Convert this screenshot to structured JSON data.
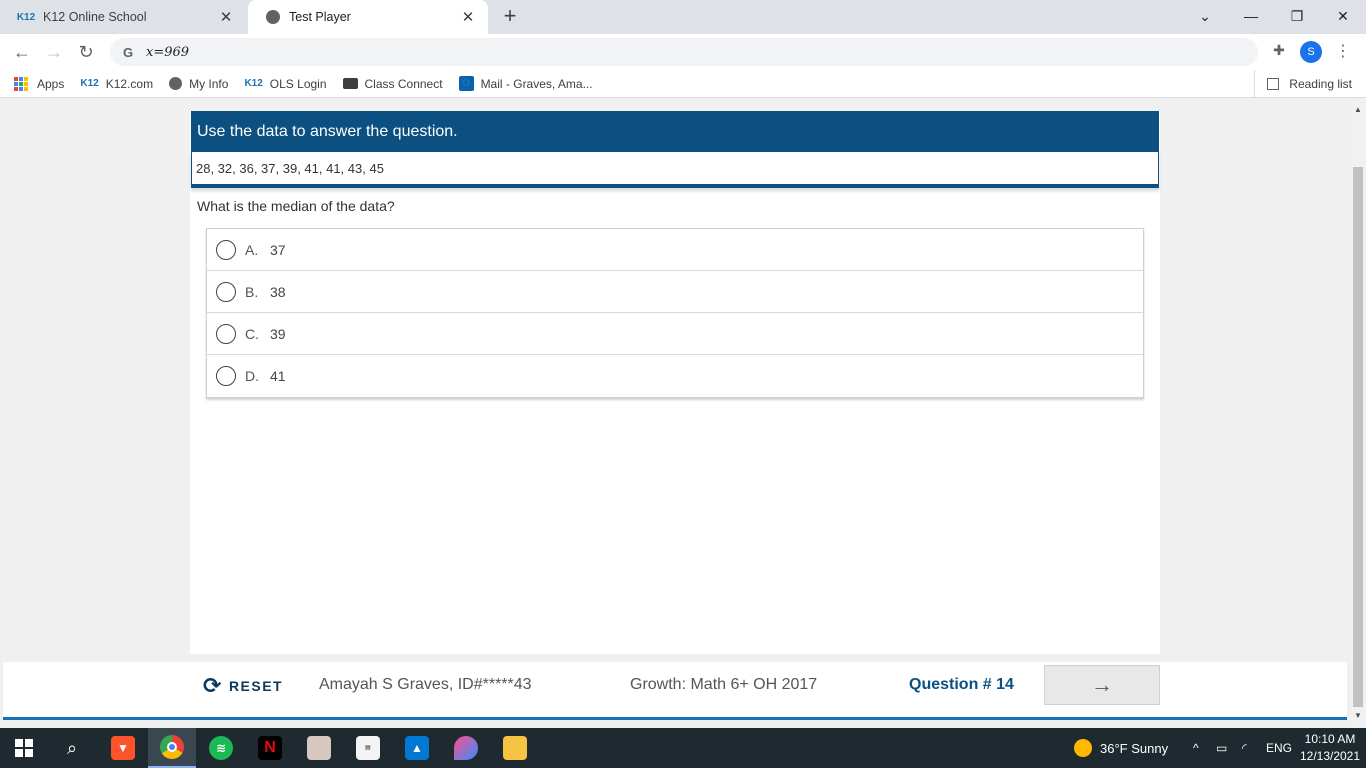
{
  "browser": {
    "tabs": [
      {
        "label": "K12 Online School",
        "favicon": "K12"
      },
      {
        "label": "Test Player"
      }
    ],
    "url": "x=969",
    "profile_initial": "S",
    "bookmarks": [
      {
        "label": "Apps"
      },
      {
        "label": "K12.com",
        "favicon": "K12"
      },
      {
        "label": "My Info"
      },
      {
        "label": "OLS Login",
        "favicon": "K12"
      },
      {
        "label": "Class Connect"
      },
      {
        "label": "Mail - Graves, Ama..."
      }
    ],
    "reading_list": "Reading list"
  },
  "stimulus": {
    "header": "Use the data to answer the question.",
    "data": "28, 32, 36, 37, 39, 41, 41, 43, 45"
  },
  "question": {
    "prompt": "What is the median of the data?",
    "choices": [
      {
        "letter": "A.",
        "value": "37"
      },
      {
        "letter": "B.",
        "value": "38"
      },
      {
        "letter": "C.",
        "value": "39"
      },
      {
        "letter": "D.",
        "value": "41"
      }
    ]
  },
  "footer": {
    "reset_label": "RESET",
    "student": "Amayah S Graves, ID#*****43",
    "test_name": "Growth: Math 6+ OH 2017",
    "question_number": "Question # 14"
  },
  "taskbar": {
    "weather": "36°F  Sunny",
    "language": "ENG",
    "time": "10:10 AM",
    "date": "12/13/2021"
  },
  "colors": {
    "header_blue": "#0b5080",
    "footer_accent": "#1670b5"
  }
}
